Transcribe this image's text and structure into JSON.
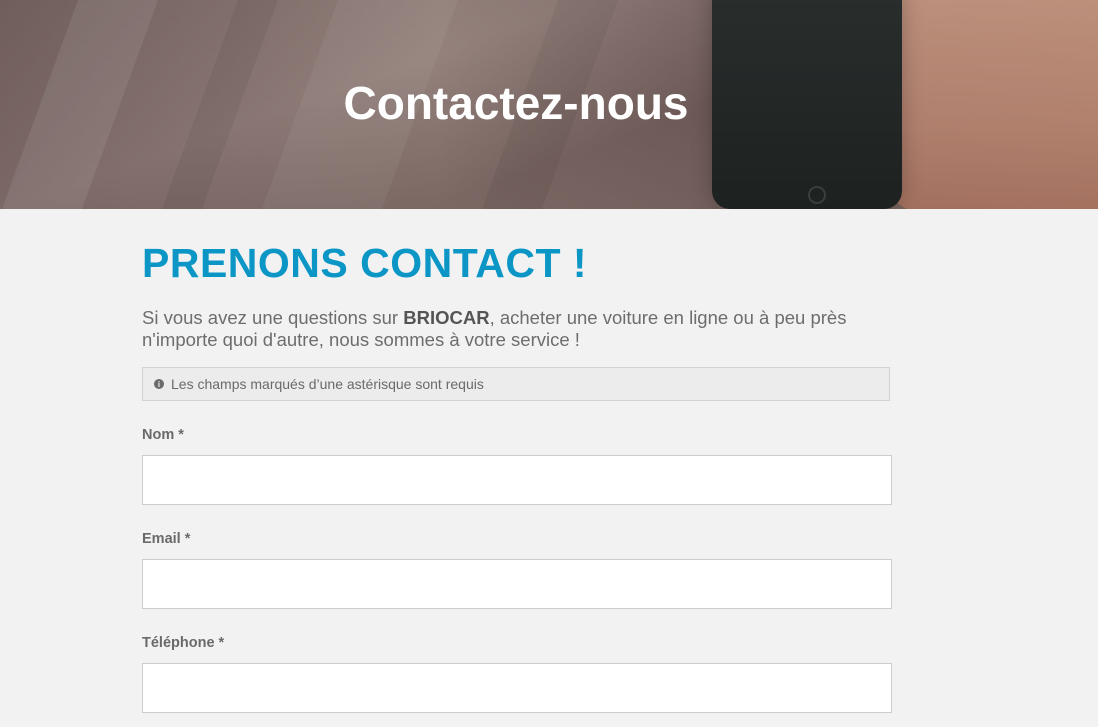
{
  "hero": {
    "title": "Contactez-nous"
  },
  "section": {
    "title": "PRENONS CONTACT !",
    "intro_before": "Si vous avez une questions sur ",
    "intro_brand": "BRIOCAR",
    "intro_after": ", acheter une voiture en ligne ou à peu près n'importe quoi d'autre, nous sommes à votre service !",
    "notice": "Les champs marqués d’une astérisque sont requis",
    "notice_icon": "info-icon"
  },
  "form": {
    "fields": [
      {
        "label": "Nom *",
        "value": "",
        "placeholder": ""
      },
      {
        "label": "Email *",
        "value": "",
        "placeholder": ""
      },
      {
        "label": "Téléphone *",
        "value": "",
        "placeholder": ""
      }
    ]
  },
  "colors": {
    "accent": "#0b96c6",
    "background": "#f2f2f2"
  }
}
